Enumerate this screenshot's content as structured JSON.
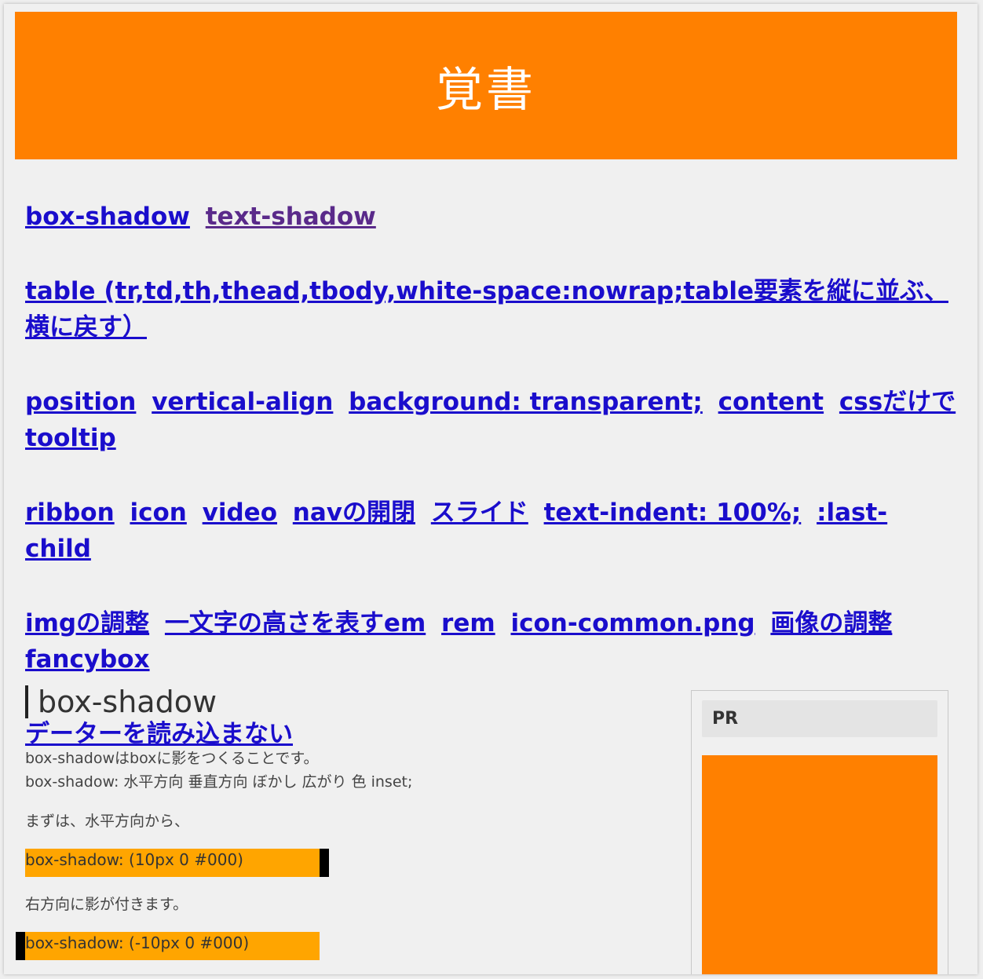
{
  "site": {
    "title": "覚書",
    "header_color": "#ff8000"
  },
  "link_rows": [
    [
      {
        "label": "box-shadow"
      },
      {
        "label": "text-shadow",
        "visited": true
      }
    ],
    [
      {
        "label": "table (tr,td,th,thead,tbody,white-space:nowrap;table要素を縦に並ぶ、横に戻す）"
      }
    ],
    [
      {
        "label": "position"
      },
      {
        "label": "vertical-align"
      },
      {
        "label": "background: transparent;"
      },
      {
        "label": "content"
      },
      {
        "label": "cssだけでtooltip"
      }
    ],
    [
      {
        "label": "ribbon"
      },
      {
        "label": "icon"
      },
      {
        "label": "video"
      },
      {
        "label": "navの開閉"
      },
      {
        "label": "スライド"
      },
      {
        "label": "text-indent: 100%;"
      },
      {
        "label": ":last-child"
      }
    ],
    [
      {
        "label": "imgの調整"
      },
      {
        "label": "一文字の高さを表すem"
      },
      {
        "label": "rem"
      },
      {
        "label": "icon-common.png"
      },
      {
        "label": "画像の調整"
      },
      {
        "label": "fancybox"
      }
    ],
    [
      {
        "label": "データーを読み込まない"
      }
    ]
  ],
  "article": {
    "heading": "box-shadow",
    "intro_line1": "box-shadowはboxに影をつくることです。",
    "intro_line2": "box-shadow: 水平方向 垂直方向 ぼかし 広がり 色 inset;",
    "step1": "まずは、水平方向から、",
    "demo1_label": "box-shadow: (10px 0 #000)",
    "step2": "右方向に影が付きます。",
    "demo2_label": "box-shadow: (-10px 0 #000)",
    "demo_color": "#ffa500"
  },
  "sidebar": {
    "pr_label": "PR",
    "ad_color": "#ff8000"
  }
}
